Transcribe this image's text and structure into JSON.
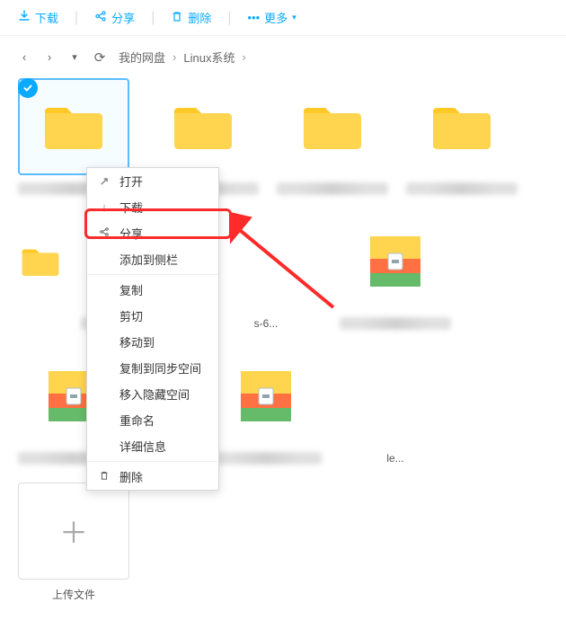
{
  "toolbar": {
    "download": "下载",
    "share": "分享",
    "delete": "删除",
    "more": "更多"
  },
  "breadcrumb": {
    "root": "我的网盘",
    "path1": "Linux系统"
  },
  "grid": {
    "file_label_visible": "s-6...",
    "file_label_visible2": "le...",
    "upload_label": "上传文件"
  },
  "context_menu": {
    "open": "打开",
    "download": "下载",
    "share": "分享",
    "add_sidebar": "添加到侧栏",
    "copy": "复制",
    "cut": "剪切",
    "move": "移动到",
    "sync_copy": "复制到同步空间",
    "hidden_move": "移入隐藏空间",
    "rename": "重命名",
    "details": "详细信息",
    "delete": "删除"
  },
  "icons": {
    "share_glyph": "⚬",
    "download_glyph": "↓",
    "delete_glyph": "🗑",
    "more_glyph": "•••",
    "back_glyph": "‹",
    "forward_glyph": "›",
    "dropdown_glyph": "▾",
    "refresh_glyph": "⟳",
    "check_glyph": "✓",
    "expand_glyph": "↗",
    "plus_glyph": "＋"
  }
}
